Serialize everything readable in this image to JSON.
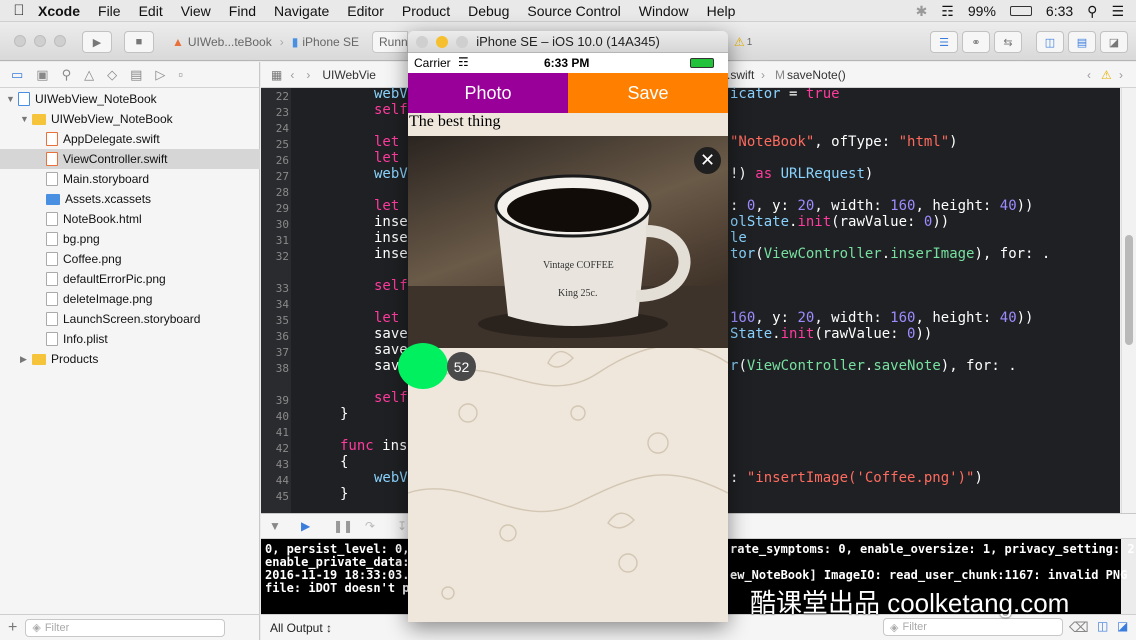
{
  "menubar": {
    "app": "Xcode",
    "items": [
      "File",
      "Edit",
      "View",
      "Find",
      "Navigate",
      "Editor",
      "Product",
      "Debug",
      "Source Control",
      "Window",
      "Help"
    ],
    "battery": "99%",
    "time": "6:33"
  },
  "toolbar": {
    "scheme": "UIWeb...teBook",
    "device": "iPhone SE",
    "status": "Runni",
    "warning_count": "1"
  },
  "navigator": {
    "rows": [
      {
        "label": "UIWebView_NoteBook",
        "kind": "project",
        "indent": 0,
        "open": true
      },
      {
        "label": "UIWebView_NoteBook",
        "kind": "folder",
        "indent": 1,
        "open": true
      },
      {
        "label": "AppDelegate.swift",
        "kind": "swift",
        "indent": 2
      },
      {
        "label": "ViewController.swift",
        "kind": "swift",
        "indent": 2,
        "selected": true
      },
      {
        "label": "Main.storyboard",
        "kind": "file",
        "indent": 2
      },
      {
        "label": "Assets.xcassets",
        "kind": "bluefolder",
        "indent": 2
      },
      {
        "label": "NoteBook.html",
        "kind": "file",
        "indent": 2
      },
      {
        "label": "bg.png",
        "kind": "file",
        "indent": 2
      },
      {
        "label": "Coffee.png",
        "kind": "file",
        "indent": 2
      },
      {
        "label": "defaultErrorPic.png",
        "kind": "file",
        "indent": 2
      },
      {
        "label": "deleteImage.png",
        "kind": "file",
        "indent": 2
      },
      {
        "label": "LaunchScreen.storyboard",
        "kind": "file",
        "indent": 2
      },
      {
        "label": "Info.plist",
        "kind": "file",
        "indent": 2
      },
      {
        "label": "Products",
        "kind": "folder",
        "indent": 1,
        "open": false
      }
    ],
    "filter_placeholder": "Filter"
  },
  "jumpbar": {
    "project": "UIWebVie",
    "file": ".swift",
    "method": "saveNote()"
  },
  "editor": {
    "lines": [
      "22",
      "23",
      "24",
      "25",
      "26",
      "27",
      "28",
      "29",
      "30",
      "31",
      "32",
      "33",
      "34",
      "35",
      "36",
      "37",
      "38",
      "39",
      "40",
      "41",
      "42",
      "43",
      "44",
      "45"
    ]
  },
  "console": {
    "lines": [
      "0, persist_level: 0,",
      "enable_private_data:",
      "2016-11-19 18:33:03.1",
      "file: iDOT doesn't po"
    ],
    "right_lines": [
      "rate_symptoms: 0, enable_oversize: 1, privacy_setting: 2,",
      "ew_NoteBook] ImageIO: read_user_chunk:1167: invalid PNG"
    ],
    "output_label": "All Output ↕",
    "filter_placeholder": "Filter"
  },
  "simulator": {
    "title": "iPhone SE – iOS 10.0 (14A345)",
    "carrier": "Carrier",
    "time": "6:33 PM",
    "photo_label": "Photo",
    "save_label": "Save",
    "text": "The best thing",
    "badge": "52"
  },
  "watermark": "酷课堂出品 coolketang.com",
  "colors": {
    "photo": "#990099",
    "save": "#ff8000",
    "green": "#00f060"
  }
}
